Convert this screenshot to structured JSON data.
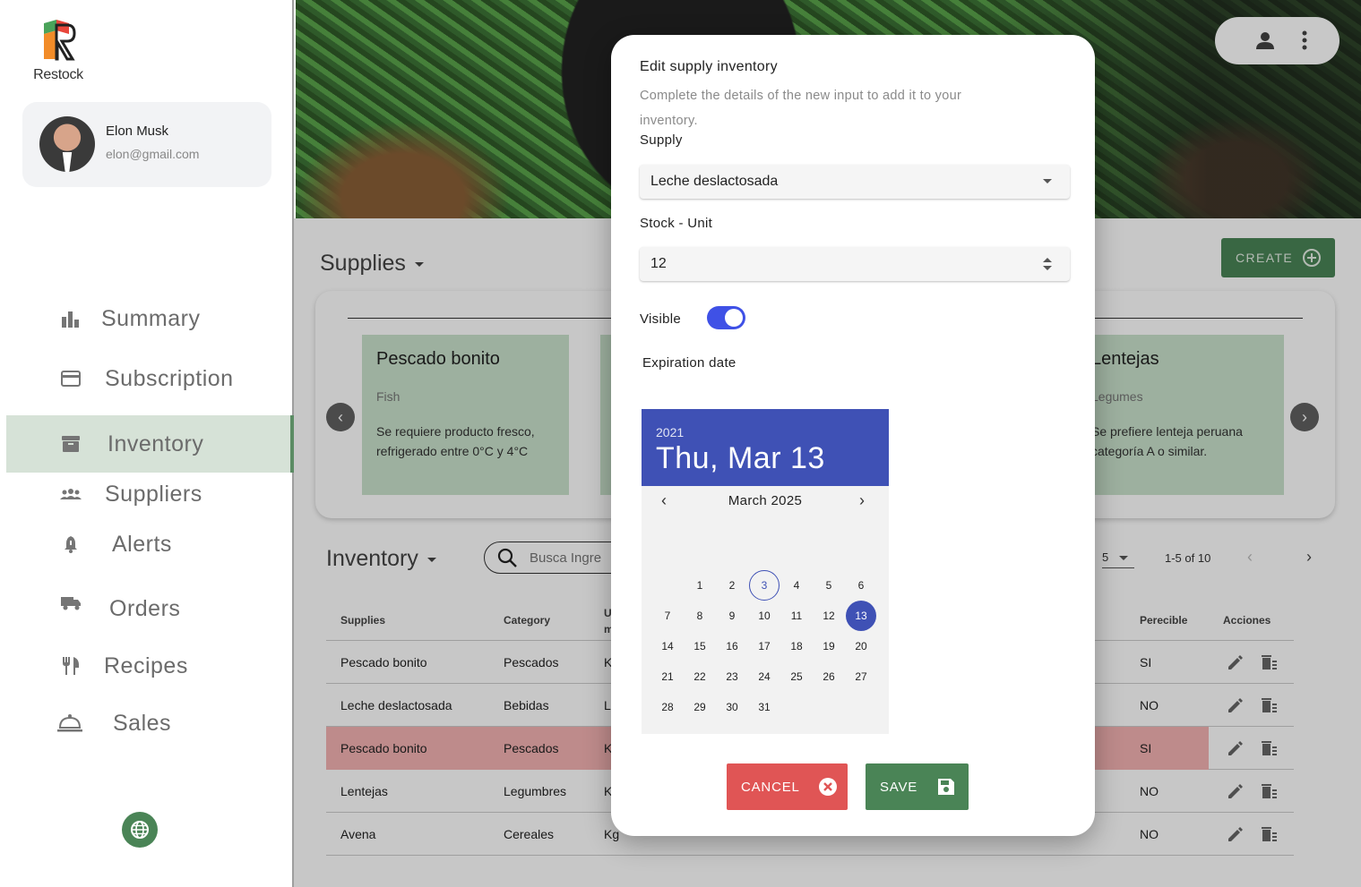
{
  "app": {
    "name": "Restock"
  },
  "user": {
    "name": "Elon Musk",
    "email": "elon@gmail.com"
  },
  "nav": [
    {
      "label": "Summary",
      "icon": "bar-chart-icon"
    },
    {
      "label": "Subscription",
      "icon": "credit-card-icon"
    },
    {
      "label": "Inventory",
      "icon": "archive-icon",
      "active": true
    },
    {
      "label": "Suppliers",
      "icon": "people-icon"
    },
    {
      "label": "Alerts",
      "icon": "bell-icon"
    },
    {
      "label": "Orders",
      "icon": "truck-icon"
    },
    {
      "label": "Recipes",
      "icon": "utensils-icon"
    },
    {
      "label": "Sales",
      "icon": "room-service-icon"
    }
  ],
  "supplies_section": {
    "title": "Supplies",
    "create_label": "CREATE"
  },
  "cards": [
    {
      "title": "Pescado bonito",
      "category": "Fish",
      "description": "Se requiere producto fresco, refrigerado entre 0°C y 4°C"
    },
    {
      "title": "Lentejas",
      "category": "Legumes",
      "description": "Se prefiere lenteja peruana categoría A o similar."
    }
  ],
  "inventory_section": {
    "title": "Inventory",
    "search_placeholder": "Busca Ingre",
    "page_size": "5",
    "range": "1-5 of 10"
  },
  "table": {
    "headers": {
      "supplies": "Supplies",
      "category": "Category",
      "unit": "U\nm",
      "perecible": "Perecible",
      "acciones": "Acciones"
    },
    "rows": [
      {
        "supply": "Pescado bonito",
        "category": "Pescados",
        "unit": "K",
        "perecible": "SI"
      },
      {
        "supply": "Leche deslactosada",
        "category": "Bebidas",
        "unit": "L",
        "perecible": "NO"
      },
      {
        "supply": "Pescado bonito",
        "category": "Pescados",
        "unit": "K",
        "perecible": "SI",
        "highlight": true
      },
      {
        "supply": "Lentejas",
        "category": "Legumbres",
        "unit": "K",
        "perecible": "NO"
      },
      {
        "supply": "Avena",
        "category": "Cereales",
        "unit": "Kg",
        "perecible": "NO"
      }
    ]
  },
  "modal": {
    "title": "Edit supply inventory",
    "subtitle": "Complete the details of the new input to add it to your inventory.",
    "supply_label": "Supply",
    "supply_value": "Leche deslactosada",
    "stock_label": "Stock - Unit",
    "stock_value": "12",
    "visible_label": "Visible",
    "visible": true,
    "expiration_label": "Expiration date",
    "cancel_label": "CANCEL",
    "save_label": "SAVE"
  },
  "datepicker": {
    "year": "2021",
    "selected_display": "Thu, Mar 13",
    "month_label": "March 2025",
    "days": [
      {
        "d": "1",
        "r": 0,
        "c": 1
      },
      {
        "d": "2",
        "r": 0,
        "c": 2
      },
      {
        "d": "3",
        "r": 0,
        "c": 3,
        "today": true
      },
      {
        "d": "4",
        "r": 0,
        "c": 4
      },
      {
        "d": "5",
        "r": 0,
        "c": 5
      },
      {
        "d": "6",
        "r": 0,
        "c": 6
      },
      {
        "d": "7",
        "r": 1,
        "c": 0
      },
      {
        "d": "8",
        "r": 1,
        "c": 1
      },
      {
        "d": "9",
        "r": 1,
        "c": 2
      },
      {
        "d": "10",
        "r": 1,
        "c": 3
      },
      {
        "d": "11",
        "r": 1,
        "c": 4
      },
      {
        "d": "12",
        "r": 1,
        "c": 5
      },
      {
        "d": "13",
        "r": 1,
        "c": 6,
        "selected": true
      },
      {
        "d": "14",
        "r": 2,
        "c": 0
      },
      {
        "d": "15",
        "r": 2,
        "c": 1
      },
      {
        "d": "16",
        "r": 2,
        "c": 2
      },
      {
        "d": "17",
        "r": 2,
        "c": 3
      },
      {
        "d": "18",
        "r": 2,
        "c": 4
      },
      {
        "d": "19",
        "r": 2,
        "c": 5
      },
      {
        "d": "20",
        "r": 2,
        "c": 6
      },
      {
        "d": "21",
        "r": 3,
        "c": 0
      },
      {
        "d": "22",
        "r": 3,
        "c": 1
      },
      {
        "d": "23",
        "r": 3,
        "c": 2
      },
      {
        "d": "24",
        "r": 3,
        "c": 3
      },
      {
        "d": "25",
        "r": 3,
        "c": 4
      },
      {
        "d": "26",
        "r": 3,
        "c": 5
      },
      {
        "d": "27",
        "r": 3,
        "c": 6
      },
      {
        "d": "28",
        "r": 4,
        "c": 0
      },
      {
        "d": "29",
        "r": 4,
        "c": 1
      },
      {
        "d": "30",
        "r": 4,
        "c": 2
      },
      {
        "d": "31",
        "r": 4,
        "c": 3
      }
    ]
  },
  "colors": {
    "brand_green": "#4a8456",
    "primary_blue": "#3f51b5",
    "danger_red": "#e05555"
  }
}
